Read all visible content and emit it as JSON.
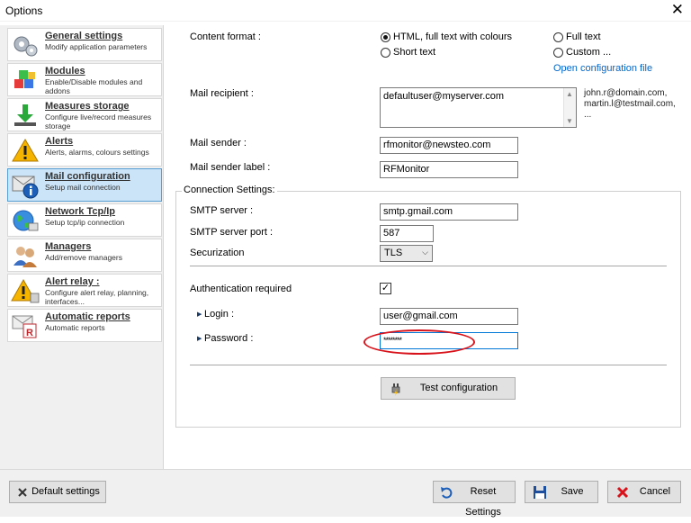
{
  "window": {
    "title": "Options",
    "close_symbol": "✕"
  },
  "sidebar": {
    "items": [
      {
        "title": "General settings",
        "desc": "Modify application parameters",
        "icon": "gears-icon"
      },
      {
        "title": "Modules",
        "desc": "Enable/Disable modules and addons",
        "icon": "modules-icon"
      },
      {
        "title": "Measures storage",
        "desc": "Configure live/record measures storage",
        "icon": "download-icon"
      },
      {
        "title": "Alerts",
        "desc": "Alerts, alarms, colours settings",
        "icon": "warning-icon"
      },
      {
        "title": "Mail configuration",
        "desc": "Setup mail connection",
        "icon": "mail-info-icon",
        "active": true
      },
      {
        "title": "Network Tcp/Ip",
        "desc": "Setup tcp/ip connection",
        "icon": "globe-icon"
      },
      {
        "title": "Managers",
        "desc": "Add/remove managers",
        "icon": "users-icon"
      },
      {
        "title": "Alert relay :",
        "desc": "Configure alert relay, planning, interfaces...",
        "icon": "relay-warning-icon"
      },
      {
        "title": "Automatic reports",
        "desc": "Automatic reports",
        "icon": "report-icon"
      }
    ]
  },
  "form": {
    "content_format_label": "Content format :",
    "options": {
      "html": "HTML, full text with colours",
      "full": "Full text",
      "short": "Short text",
      "custom": "Custom ..."
    },
    "open_config_link": "Open configuration file",
    "mail_recipient_label": "Mail recipient :",
    "mail_recipient_value": "defaultuser@myserver.com",
    "recipient_hint_1": "john.r@domain.com,",
    "recipient_hint_2": "martin.l@testmail.com,",
    "recipient_hint_3": "...",
    "mail_sender_label": "Mail sender :",
    "mail_sender_value": "rfmonitor@newsteo.com",
    "sender_label_label": "Mail sender label :",
    "sender_label_value": "RFMonitor",
    "connection_settings_label": "Connection Settings:",
    "smtp_server_label": "SMTP server :",
    "smtp_server_value": "smtp.gmail.com",
    "smtp_port_label": "SMTP server port :",
    "smtp_port_value": "587",
    "securization_label": "Securization",
    "securization_value": "TLS",
    "auth_label": "Authentication required",
    "auth_checkmark": "✓",
    "login_label": "Login :",
    "login_value": "user@gmail.com",
    "password_label": "Password :",
    "password_value": "********",
    "test_button": "Test configuration"
  },
  "footer": {
    "default_settings": "Default settings",
    "reset_settings": "Reset Settings",
    "save": "Save",
    "cancel": "Cancel"
  },
  "colors": {
    "active_item_bg": "#cce4f7",
    "link": "#0066cc",
    "annotation_ellipse": "#d8121a"
  }
}
